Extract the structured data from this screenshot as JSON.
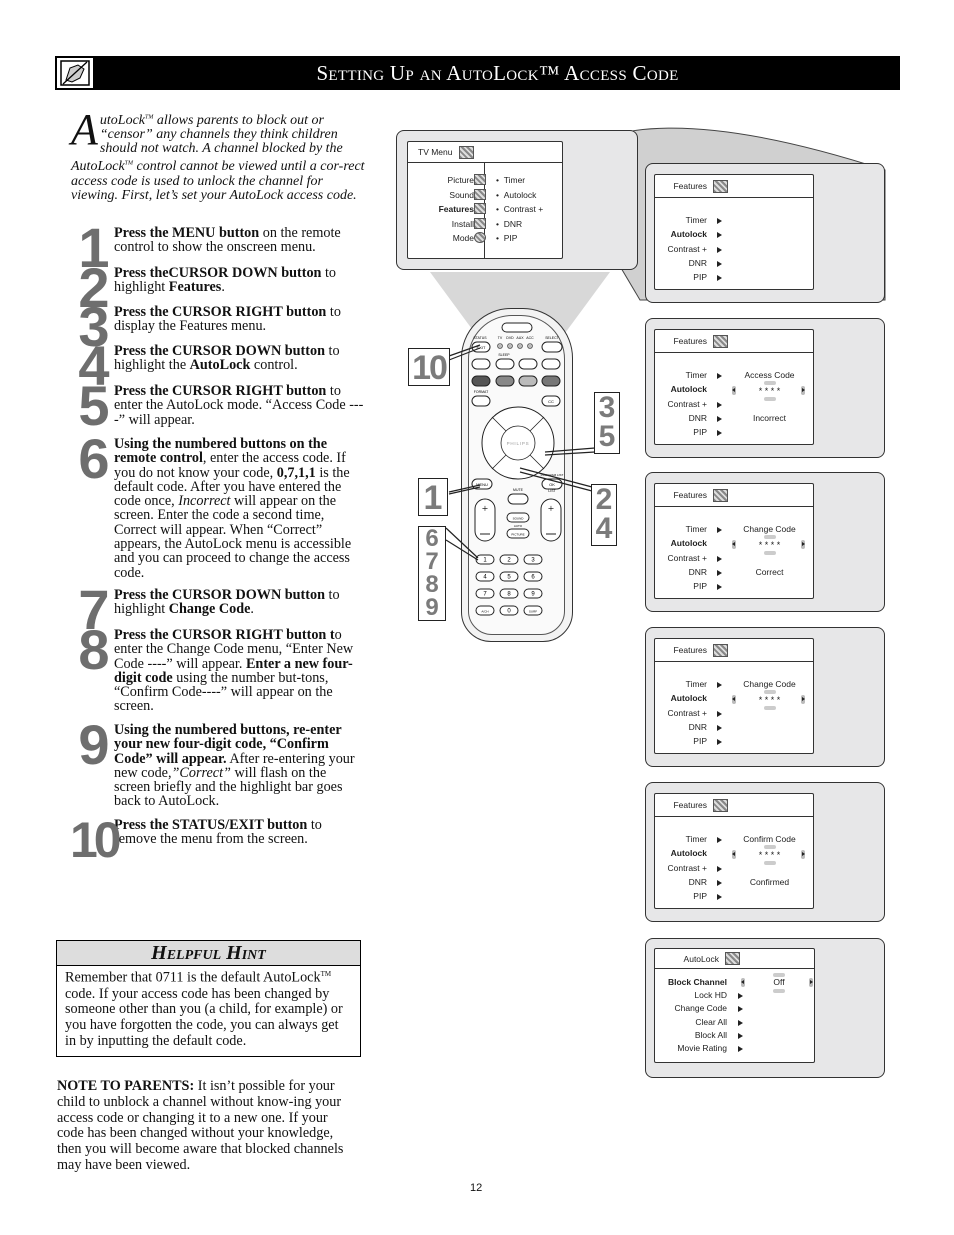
{
  "header": {
    "title": "Setting Up an AutoLock™ Access Code",
    "icon": "hand-with-pencil-icon"
  },
  "intro": {
    "dropcap": "A",
    "text_html": "utoLock<sup style=\"font-size:6px\">TM</sup> allows parents to block out or “censor” any channels they think children should not watch.  A channel blocked by the AutoLock<sup style=\"font-size:6px\">TM</sup> control cannot be viewed until a cor-rect access code is used to unlock the channel for viewing.  First, let’s set your AutoLock access code."
  },
  "steps": [
    {
      "num": "1",
      "bold": "Press the MENU button",
      "rest": " on the remote control to show the onscreen menu."
    },
    {
      "num": "2",
      "bold": "Press theCURSOR DOWN button",
      "rest": " to highlight ",
      "bold2": "Features",
      "rest2": "."
    },
    {
      "num": "3",
      "bold": "Press the CURSOR RIGHT button",
      "rest": " to display the Features menu."
    },
    {
      "num": "4",
      "bold": "Press the CURSOR DOWN button",
      "rest": " to highlight the ",
      "bold2": "AutoLock",
      "rest2": " control."
    },
    {
      "num": "5",
      "bold": "Press the CURSOR RIGHT button",
      "rest": " to enter the AutoLock mode. “Access Code ----” will appear."
    },
    {
      "num": "6",
      "bold": "Using the numbered buttons on the remote control",
      "rest": ", enter the access code. If you do not know your code, ",
      "bold2": "0,7,1,1",
      "rest2": " is the default code. After you have entered the code once, ",
      "italic": "Incorrect",
      "rest3": " will appear on the screen. Enter the code a second time, Correct will appear.  When “Correct” appears, the AutoLock menu is accessible and you can proceed to change the access code."
    },
    {
      "num": "7",
      "bold": "Press the CURSOR DOWN button",
      "rest": " to highlight ",
      "bold2": "Change Code",
      "rest2": "."
    },
    {
      "num": "8",
      "bold": "Press the CURSOR RIGHT button t",
      "rest": "o enter the Change Code menu, “Enter New Code ----” will appear. ",
      "bold2": "Enter a new four-digit code",
      "rest2": " using the number but-tons, “Confirm Code----” will appear on the screen."
    },
    {
      "num": "9",
      "bold": "Using the numbered buttons, re-enter your new four-digit code, “Confirm Code” will appear.",
      "rest": " After re-entering your new code,",
      "italic": "”Correct”",
      "rest3": "  will flash on the screen briefly and the highlight bar goes back to AutoLock."
    },
    {
      "num": "10",
      "bold": "Press the STATUS/EXIT button",
      "rest": " to remove the menu from the screen."
    }
  ],
  "hint": {
    "title": "Helpful Hint",
    "body_html": "Remember that 0711 is the default AutoLock<sup style=\"font-size:7px\">TM</sup> code.  If your access code has been changed by someone other than you (a child, for example) or you have forgotten the code, you can always get in by inputting the default code."
  },
  "note": {
    "label": "NOTE TO PARENTS:",
    "text": "  It isn’t possible for your child to unblock a channel without know-ing your access code or changing it to a new one.  If your code has been changed without your knowledge, then you will become aware that blocked channels may have been viewed."
  },
  "page_number": "12",
  "tv_menu": {
    "title": "TV Menu",
    "left_items": [
      {
        "label": "Picture",
        "icon": "picture-icon",
        "bold": false
      },
      {
        "label": "Sound",
        "icon": "sound-icon",
        "bold": false
      },
      {
        "label": "Features",
        "icon": "features-icon",
        "bold": true
      },
      {
        "label": "Install",
        "icon": "install-icon",
        "bold": false
      },
      {
        "label": "Mode",
        "icon": "mode-icon",
        "bold": false
      }
    ],
    "right_items": [
      "Timer",
      "Autolock",
      "Contrast +",
      "DNR",
      "PIP"
    ]
  },
  "feature_screens": [
    {
      "title": "Features",
      "items": [
        "Timer",
        "Autolock",
        "Contrast +",
        "DNR",
        "PIP"
      ],
      "bold_index": 1,
      "heading": "",
      "code": "",
      "status": "",
      "show_selector": false
    },
    {
      "title": "Features",
      "items": [
        "Timer",
        "Autolock",
        "Contrast +",
        "DNR",
        "PIP"
      ],
      "bold_index": 1,
      "heading": "Access Code",
      "code": "* * * *",
      "status": "Incorrect",
      "show_selector": true
    },
    {
      "title": "Features",
      "items": [
        "Timer",
        "Autolock",
        "Contrast +",
        "DNR",
        "PIP"
      ],
      "bold_index": 1,
      "heading": "Change Code",
      "code": "* * * *",
      "status": "Correct",
      "show_selector": true
    },
    {
      "title": "Features",
      "items": [
        "Timer",
        "Autolock",
        "Contrast +",
        "DNR",
        "PIP"
      ],
      "bold_index": 1,
      "heading": "Change Code",
      "code": "* * * *",
      "status": "",
      "show_selector": true
    },
    {
      "title": "Features",
      "items": [
        "Timer",
        "Autolock",
        "Contrast +",
        "DNR",
        "PIP"
      ],
      "bold_index": 1,
      "heading": "Confirm Code",
      "code": "* * * *",
      "status": "Confirmed",
      "show_selector": true
    }
  ],
  "autolock_screen": {
    "title": "AutoLock",
    "items": [
      "Block Channel",
      "Lock HD",
      "Change Code",
      "Clear All",
      "Block All",
      "Movie Rating"
    ],
    "bold_index": 0,
    "value": "Off"
  },
  "remote": {
    "brand": "PHILIPS",
    "labels": {
      "status": "STATUS",
      "exit": "EXIT",
      "select": "SELECT",
      "tv": "TV",
      "dvd": "DVD",
      "aux": "AUX",
      "acc": "ACC",
      "sleep": "SLEEP",
      "format": "FORMAT",
      "cc": "CC",
      "menu": "MENU",
      "ok": "OK",
      "program_list": "PROGRAM LIST",
      "mute": "MUTE",
      "list": "LIST",
      "sound": "SOUND",
      "auto": "AUTO",
      "picture": "PICTURE",
      "ch": "CH",
      "a_ch": "A/CH",
      "surf": "SURF"
    },
    "digits": [
      "1",
      "2",
      "3",
      "4",
      "5",
      "6",
      "7",
      "8",
      "9",
      "A/CH",
      "0",
      "SURF"
    ]
  },
  "callouts": {
    "c10": "10",
    "c35": [
      "3",
      "5"
    ],
    "c1": "1",
    "c24": [
      "2",
      "4"
    ],
    "c6789": [
      "6",
      "7",
      "8",
      "9"
    ]
  }
}
